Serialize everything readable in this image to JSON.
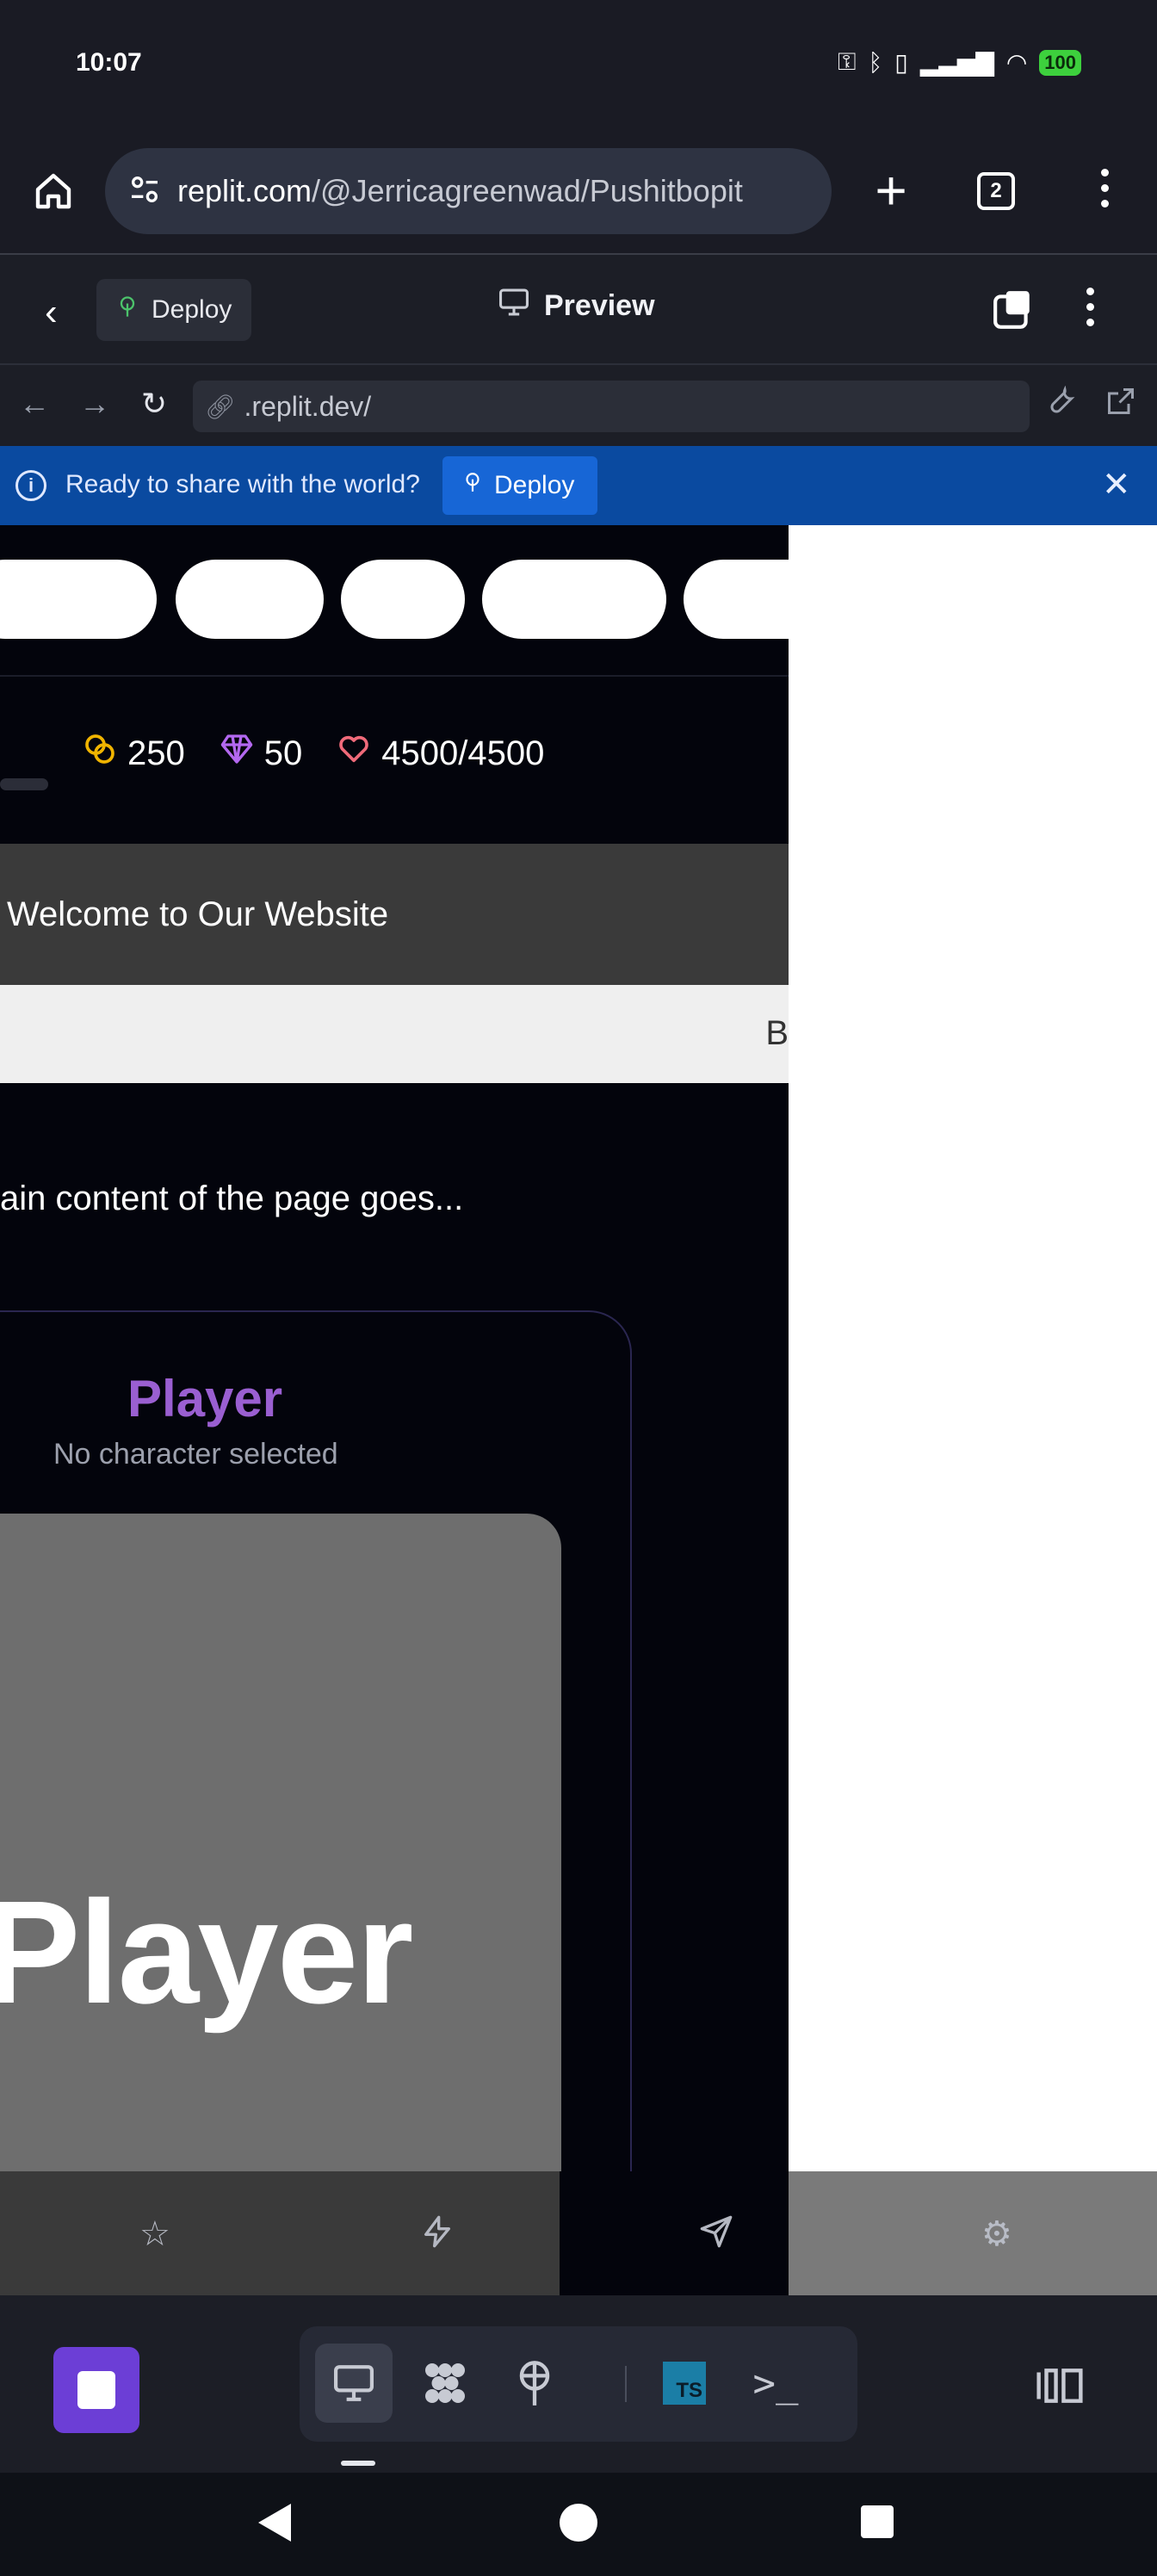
{
  "status_bar": {
    "time": "10:07",
    "battery": "100"
  },
  "browser": {
    "url_domain": "replit.com",
    "url_path": "/@Jerricagreenwad/Pushitbopit",
    "tab_count": "2"
  },
  "replit_header": {
    "deploy_label": "Deploy",
    "preview_label": "Preview"
  },
  "address_bar": {
    "url": ".replit.dev/"
  },
  "banner": {
    "message": "Ready to share with the world?",
    "deploy_label": "Deploy"
  },
  "page": {
    "stats": {
      "coins": "250",
      "gems": "50",
      "health": "4500/4500"
    },
    "welcome": "Welcome to Our Website",
    "band_letter": "B",
    "main_text": "ain content of the page goes...",
    "player_title": "Player",
    "player_subtitle": "No character selected",
    "avatar_text": "Player"
  },
  "colors": {
    "accent": "#6c3ed6",
    "banner_bg": "#0a4aa0",
    "player_title": "#9a5fd1"
  },
  "icons": [
    "home-icon",
    "site-settings-icon",
    "plus-icon",
    "tabs-icon",
    "more-icon",
    "back-icon",
    "deploy-icon",
    "monitor-icon",
    "stack-icon",
    "arrow-left-icon",
    "arrow-right-icon",
    "reload-icon",
    "link-icon",
    "wrench-icon",
    "external-link-icon",
    "info-icon",
    "close-icon",
    "coin-icon",
    "gem-icon",
    "heart-icon",
    "star-icon",
    "bolt-icon",
    "send-icon",
    "gear-icon",
    "stop-icon",
    "preview-tool-icon",
    "packages-icon",
    "deploy-tool-icon",
    "typescript-icon",
    "shell-icon",
    "split-view-icon"
  ]
}
